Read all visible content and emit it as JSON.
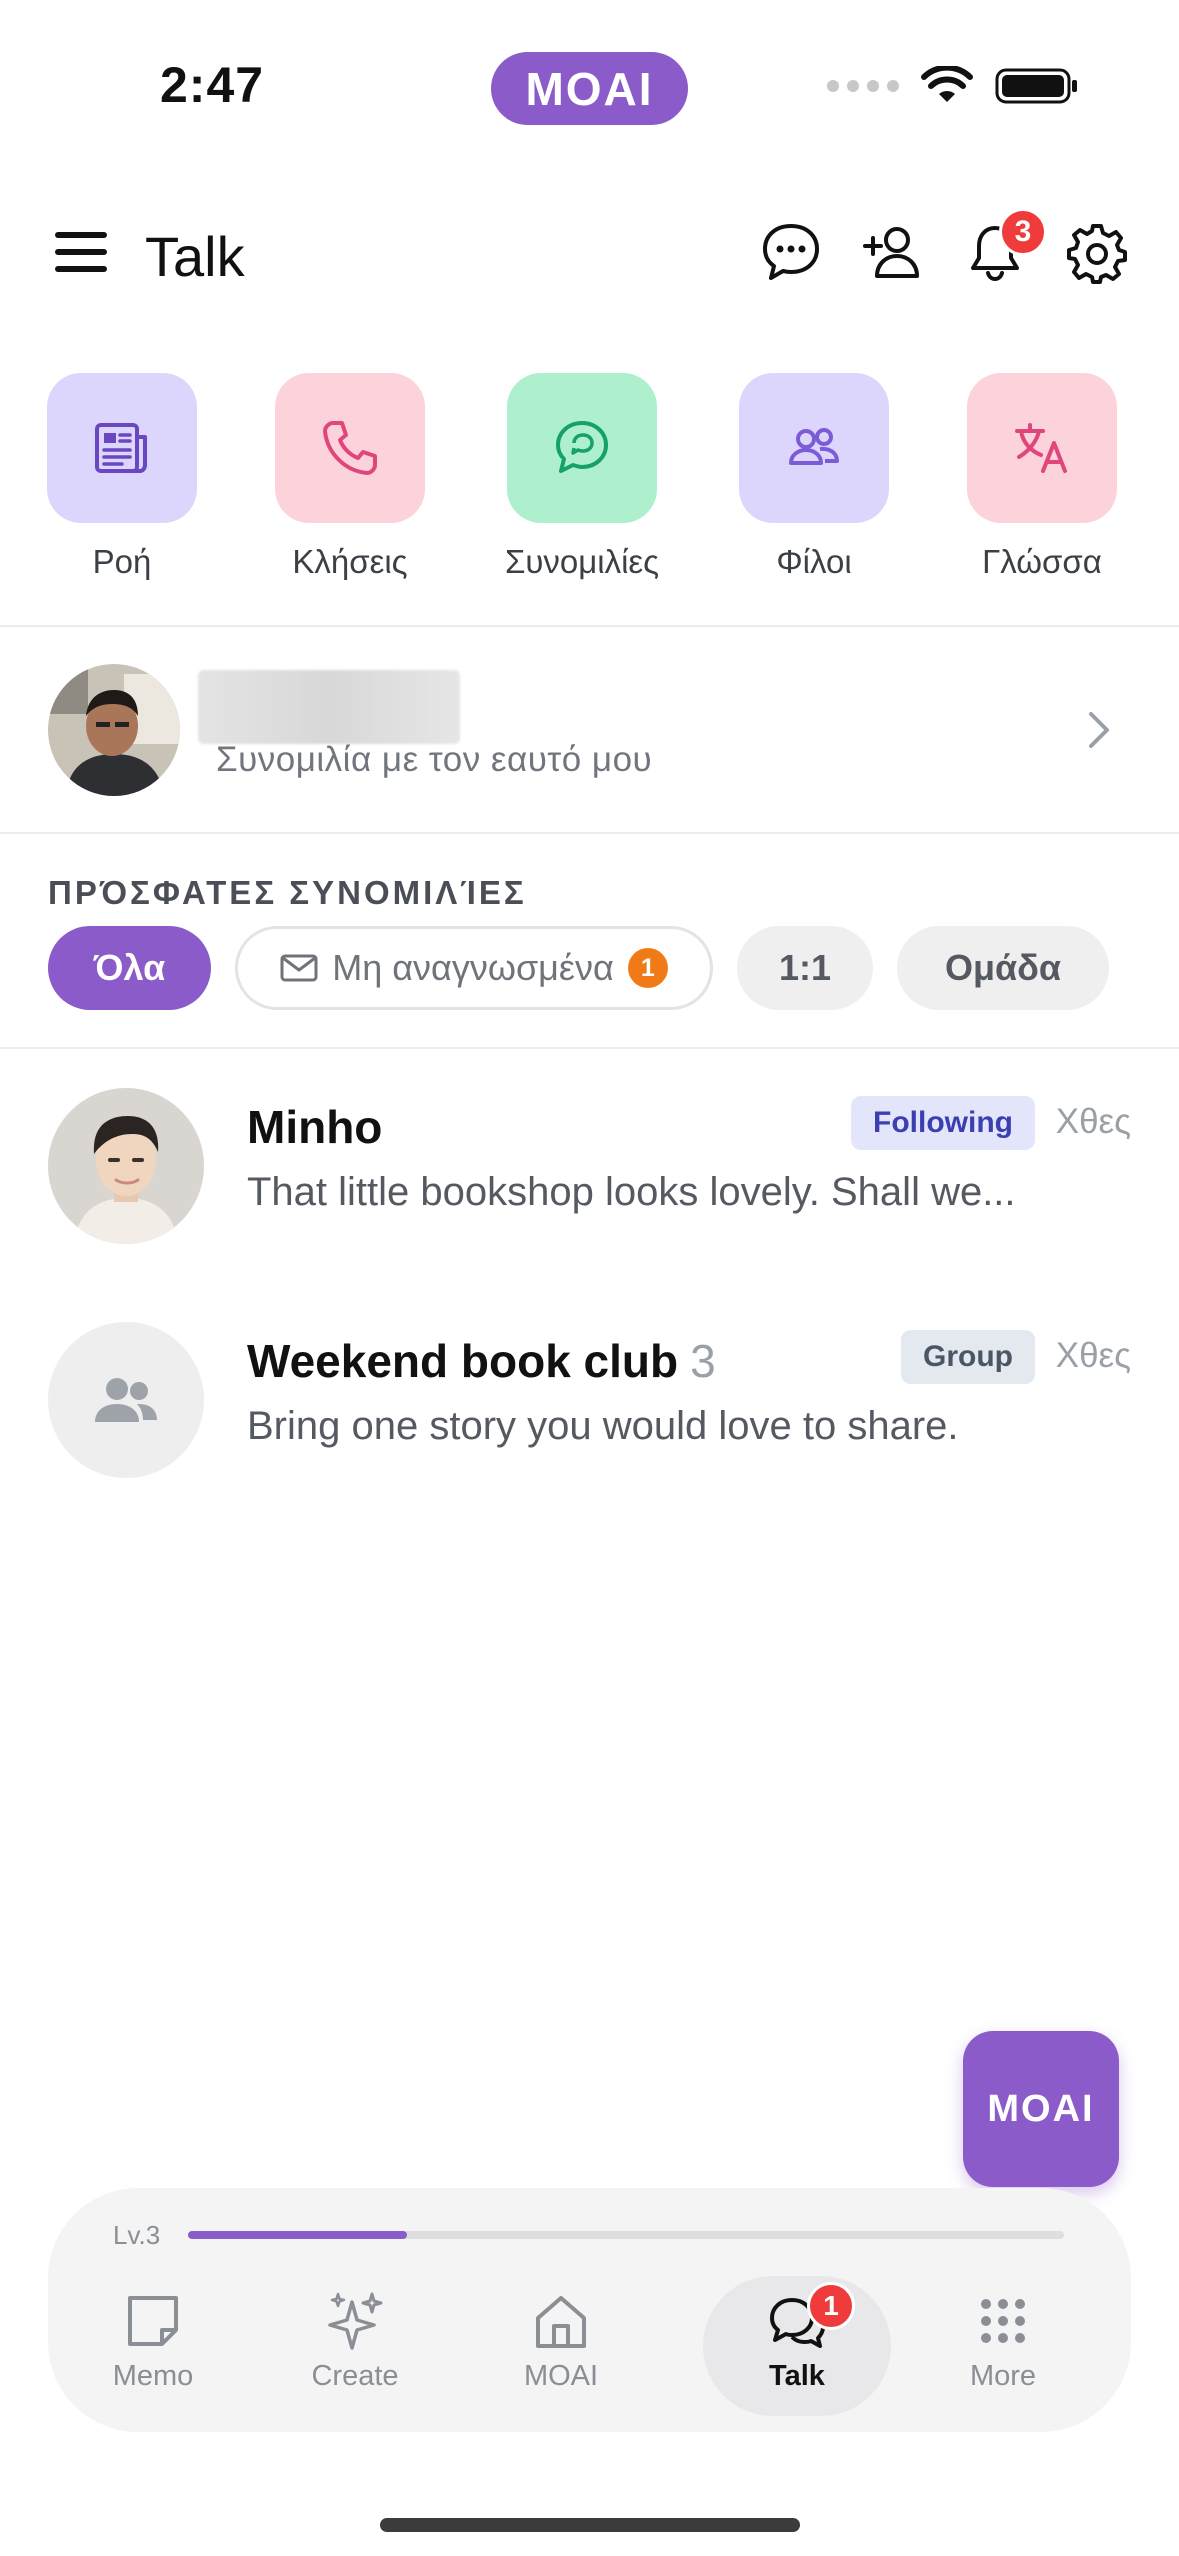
{
  "status_bar": {
    "time": "2:47",
    "app_pill": "MOAI"
  },
  "header": {
    "title": "Talk",
    "notification_count": "3"
  },
  "quick_actions": [
    {
      "label": "Ροή",
      "icon": "feed-icon",
      "bg": "#ddd6fc",
      "fg": "#6b46c1"
    },
    {
      "label": "Κλήσεις",
      "icon": "phone-icon",
      "bg": "#fcd3da",
      "fg": "#e0457b"
    },
    {
      "label": "Συνομιλίες",
      "icon": "chat-bubble-icon",
      "bg": "#aef0cd",
      "fg": "#16a06a"
    },
    {
      "label": "Φίλοι",
      "icon": "friends-icon",
      "bg": "#ddd6fc",
      "fg": "#7c5cd6"
    },
    {
      "label": "Γλώσσα",
      "icon": "translate-icon",
      "bg": "#fcd3da",
      "fg": "#e0457b"
    }
  ],
  "self_chat": {
    "subtitle": "Συνομιλία με τον εαυτό μου"
  },
  "recent": {
    "title": "ΠΡΌΣΦΑΤΕΣ ΣΥΝΟΜΙΛΊΕΣ",
    "chips": {
      "all": "Όλα",
      "unread": "Μη αναγνωσμένα",
      "unread_count": "1",
      "one_on_one": "1:1",
      "group": "Ομάδα"
    }
  },
  "conversations": [
    {
      "name": "Minho",
      "preview": "That little bookshop looks lovely. Shall we...",
      "tag": "Following",
      "time": "Χθες"
    },
    {
      "name": "Weekend book club",
      "members": "3",
      "preview": "Bring one story you would love to share.",
      "tag": "Group",
      "time": "Χθες"
    }
  ],
  "fab": {
    "label": "MOAI"
  },
  "bottom_nav": {
    "level_label": "Lv.3",
    "level_progress": 0.25,
    "tabs": [
      {
        "label": "Memo",
        "icon": "memo-icon"
      },
      {
        "label": "Create",
        "icon": "sparkles-icon"
      },
      {
        "label": "MOAI",
        "icon": "home-icon"
      },
      {
        "label": "Talk",
        "icon": "talk-icon",
        "badge": "1"
      },
      {
        "label": "More",
        "icon": "grid-icon"
      }
    ]
  },
  "colors": {
    "accent": "#8b5cc9",
    "badge_red": "#ef3b3b",
    "badge_orange": "#f07a15"
  }
}
